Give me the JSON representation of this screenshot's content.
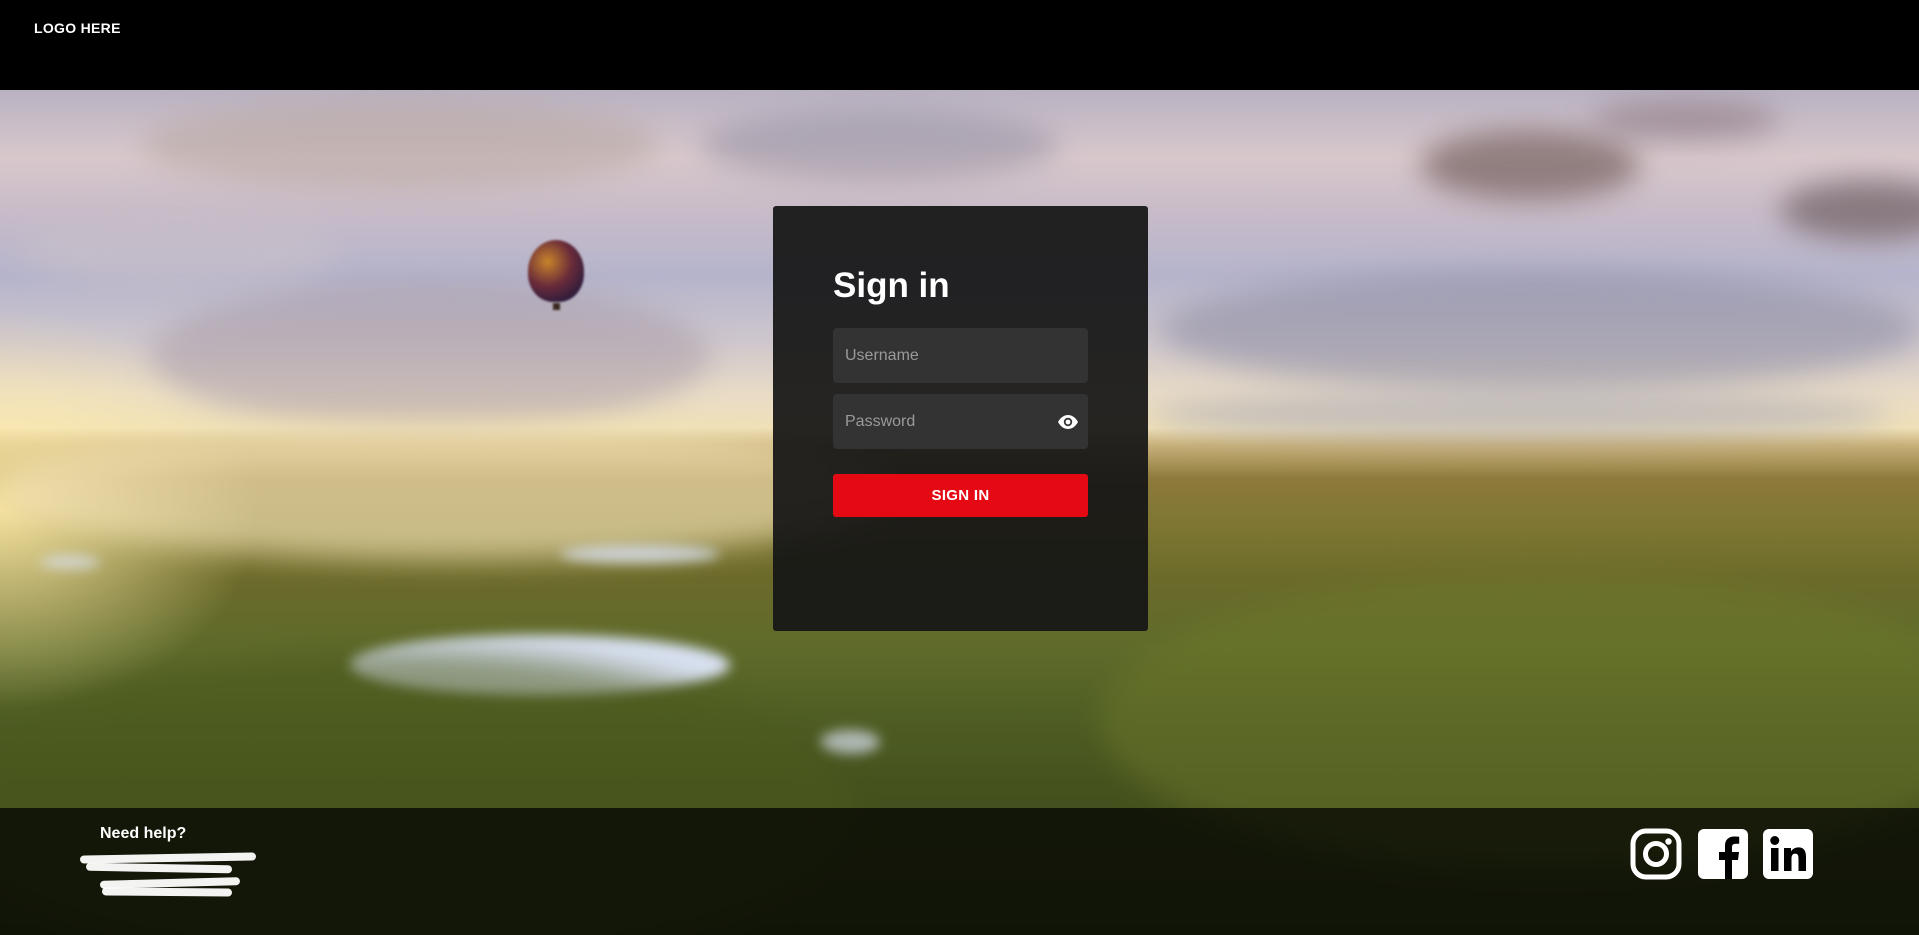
{
  "header": {
    "logo_text": "LOGO HERE"
  },
  "login": {
    "title": "Sign in",
    "username_placeholder": "Username",
    "password_placeholder": "Password",
    "submit_label": "SIGN IN"
  },
  "footer": {
    "help_title": "Need help?",
    "social_icons": [
      "instagram-icon",
      "facebook-icon",
      "linkedin-icon"
    ]
  },
  "colors": {
    "accent": "#e50914",
    "header_bg": "#000000",
    "card_bg": "#161616",
    "input_bg": "#333333",
    "text": "#ffffff"
  },
  "icons": {
    "password_toggle": "eye-icon"
  }
}
